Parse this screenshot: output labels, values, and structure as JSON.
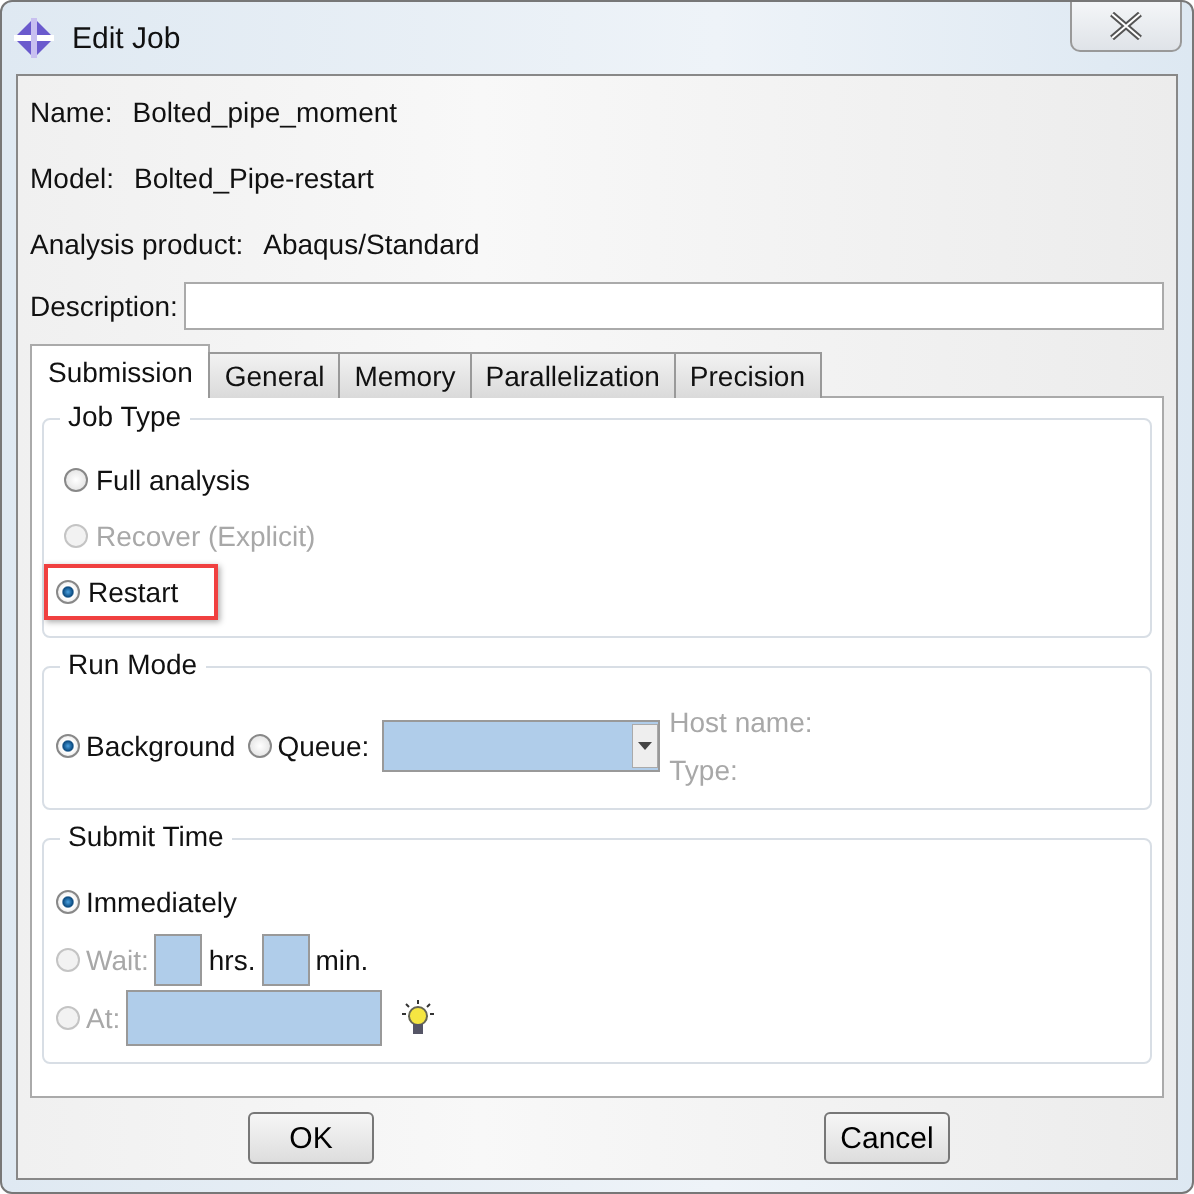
{
  "window": {
    "title": "Edit Job"
  },
  "info": [
    {
      "label": "Name:",
      "value": "Bolted_pipe_moment"
    },
    {
      "label": "Model:",
      "value": "Bolted_Pipe-restart"
    },
    {
      "label": "Analysis product:",
      "value": "Abaqus/Standard"
    }
  ],
  "description": {
    "label": "Description:"
  },
  "tabs": [
    {
      "label": "Submission",
      "selected": true
    },
    {
      "label": "General",
      "selected": false
    },
    {
      "label": "Memory",
      "selected": false
    },
    {
      "label": "Parallelization",
      "selected": false
    },
    {
      "label": "Precision",
      "selected": false
    }
  ],
  "job_type": {
    "title": "Job Type",
    "options": [
      {
        "label": "Full analysis",
        "selected": false,
        "disabled": false,
        "highlighted": false
      },
      {
        "label": "Recover (Explicit)",
        "selected": false,
        "disabled": true,
        "highlighted": false
      },
      {
        "label": "Restart",
        "selected": true,
        "disabled": false,
        "highlighted": true
      }
    ]
  },
  "run_mode": {
    "title": "Run Mode",
    "options": [
      {
        "label": "Background",
        "selected": true,
        "disabled": false
      },
      {
        "label": "Queue:",
        "selected": false,
        "disabled": false
      }
    ],
    "host_labels": [
      {
        "text": "Host name:",
        "disabled": true
      },
      {
        "text": "Type:",
        "disabled": true
      }
    ]
  },
  "submit_time": {
    "title": "Submit Time",
    "options": [
      {
        "kind": "plain",
        "label": "Immediately",
        "selected": true,
        "disabled": false
      },
      {
        "kind": "wait",
        "label": "Wait:",
        "selected": false,
        "disabled": true,
        "units": [
          "hrs.",
          "min."
        ]
      },
      {
        "kind": "at",
        "label": "At:",
        "selected": false,
        "disabled": true
      }
    ]
  },
  "buttons": [
    "OK",
    "Cancel"
  ]
}
